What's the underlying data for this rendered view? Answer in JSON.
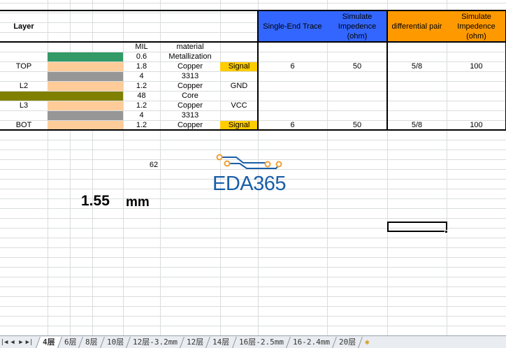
{
  "header": {
    "layer": "Layer",
    "se_trace": "Single-End Trace",
    "se_imp": "Simulate Impedence (ohm)",
    "diff_pair": "differential pair",
    "diff_imp": "Simulate Impedence (ohm)"
  },
  "col_labels": {
    "mil": "MIL",
    "material": "material"
  },
  "rows": [
    {
      "layer": "",
      "color": "#339966",
      "mil": "0.6",
      "material": "Metallization",
      "type": "",
      "se": "",
      "se_imp": "",
      "diff": "",
      "diff_imp": ""
    },
    {
      "layer": "TOP",
      "color": "#ffcc99",
      "mil": "1.8",
      "material": "Copper",
      "type": "Signal",
      "se": "6",
      "se_imp": "50",
      "diff": "5/8",
      "diff_imp": "100"
    },
    {
      "layer": "",
      "color": "#969696",
      "mil": "4",
      "material": "3313",
      "type": "",
      "se": "",
      "se_imp": "",
      "diff": "",
      "diff_imp": ""
    },
    {
      "layer": "L2",
      "color": "#ffcc99",
      "mil": "1.2",
      "material": "Copper",
      "type": "GND",
      "se": "",
      "se_imp": "",
      "diff": "",
      "diff_imp": ""
    },
    {
      "layer": "",
      "color": "#808000",
      "mil": "48",
      "material": "Core",
      "type": "",
      "se": "",
      "se_imp": "",
      "diff": "",
      "diff_imp": ""
    },
    {
      "layer": "L3",
      "color": "#ffcc99",
      "mil": "1.2",
      "material": "Copper",
      "type": "VCC",
      "se": "",
      "se_imp": "",
      "diff": "",
      "diff_imp": ""
    },
    {
      "layer": "",
      "color": "#969696",
      "mil": "4",
      "material": "3313",
      "type": "",
      "se": "",
      "se_imp": "",
      "diff": "",
      "diff_imp": ""
    },
    {
      "layer": "BOT",
      "color": "#ffcc99",
      "mil": "1.2",
      "material": "Copper",
      "type": "Signal",
      "se": "6",
      "se_imp": "50",
      "diff": "5/8",
      "diff_imp": "100"
    }
  ],
  "total_mil": "62",
  "thickness": "1.55",
  "thickness_unit": "mm",
  "logo": "EDA365",
  "colors": {
    "blue": "#3366ff",
    "orange": "#ff9900",
    "signal": "#ffcc00"
  },
  "tabs": [
    "4层",
    "6层",
    "8层",
    "10层",
    "12层-3.2mm",
    "12层",
    "14层",
    "16层-2.5mm",
    "16-2.4mm",
    "20层"
  ]
}
